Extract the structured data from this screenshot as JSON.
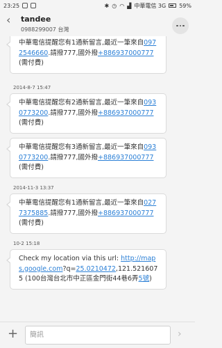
{
  "status_bar": {
    "time": "23:25",
    "carrier": "中華電信 3G",
    "battery": "59%"
  },
  "header": {
    "contact_name": "tandee",
    "contact_number": "0988299007 台灣"
  },
  "messages": [
    {
      "parts": [
        "中華電信提醒您有1通新留言,最近一筆來自",
        "0972546660",
        ".請撥777,國外撥",
        "+886937000777",
        "(需付費)"
      ]
    },
    {
      "timestamp": "2014-8-7 15:47",
      "parts": [
        "中華電信提醒您有2通新留言,最近一筆來自",
        "0930773200",
        ".請撥777,國外撥",
        "+886937000777",
        "(需付費)"
      ]
    },
    {
      "parts": [
        "中華電信提醒您有3通新留言,最近一筆來自",
        "0930773200",
        ".請撥777,國外撥",
        "+886937000777",
        "(需付費)"
      ]
    },
    {
      "timestamp": "2014-11-3 13:37",
      "parts": [
        "中華電信提醒您有1通新留言,最近一筆來自",
        "0277375885",
        ".請撥777,國外撥",
        "+886937000777",
        "(需付費)"
      ]
    },
    {
      "timestamp": "10-2 15:18",
      "parts": [
        "Check my location via this url: ",
        "http://maps.google.com",
        "?q=",
        "25.0210472",
        ",121.5216075 (100台灣台北市中正區金門街44巷6弄",
        "5號",
        ")"
      ]
    }
  ],
  "composer": {
    "placeholder": "簡訊"
  }
}
